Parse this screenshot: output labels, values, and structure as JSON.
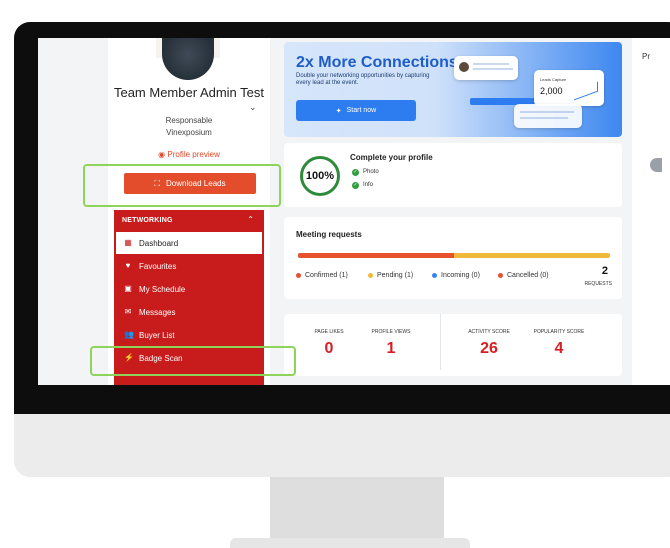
{
  "profile": {
    "name": "Team Member Admin Test",
    "role": "Responsable",
    "company": "Vinexposium",
    "preview_link": "Profile preview",
    "download_button": "Download Leads"
  },
  "nav": {
    "section": "NETWORKING",
    "items": [
      {
        "label": "Dashboard",
        "icon": "grid-icon",
        "active": true
      },
      {
        "label": "Favourites",
        "icon": "heart-icon"
      },
      {
        "label": "My Schedule",
        "icon": "calendar-icon"
      },
      {
        "label": "Messages",
        "icon": "envelope-icon"
      },
      {
        "label": "Buyer List",
        "icon": "users-icon"
      },
      {
        "label": "Badge Scan",
        "icon": "bolt-icon"
      }
    ]
  },
  "banner": {
    "title": "2x More Connections",
    "subtitle": "Double your networking opportunities by capturing every lead at the event.",
    "button": "Start now",
    "leads_title": "Leads Capture",
    "leads_value": "2,000"
  },
  "complete_profile": {
    "title": "Complete your profile",
    "percent": "100%",
    "items": [
      "Photo",
      "Info"
    ]
  },
  "meeting_requests": {
    "title": "Meeting requests",
    "legend": [
      {
        "label": "Confirmed (1)",
        "color": "#e8512e"
      },
      {
        "label": "Pending (1)",
        "color": "#f0b93a"
      },
      {
        "label": "Incoming (0)",
        "color": "#3b82f6"
      },
      {
        "label": "Cancelled (0)",
        "color": "#e8512e"
      }
    ],
    "count": "2",
    "count_label": "REQUESTS"
  },
  "stats": [
    {
      "label": "PAGE LIKES",
      "value": "0"
    },
    {
      "label": "PROFILE VIEWS",
      "value": "1"
    },
    {
      "label": "ACTIVITY SCORE",
      "value": "26"
    },
    {
      "label": "POPULARITY SCORE",
      "value": "4"
    }
  ],
  "right_panel": {
    "letter": "Pr"
  },
  "colors": {
    "brand_red": "#c81b1b",
    "accent_orange": "#e34d2b",
    "highlight": "#8ed35a",
    "blue": "#2d7df0"
  }
}
